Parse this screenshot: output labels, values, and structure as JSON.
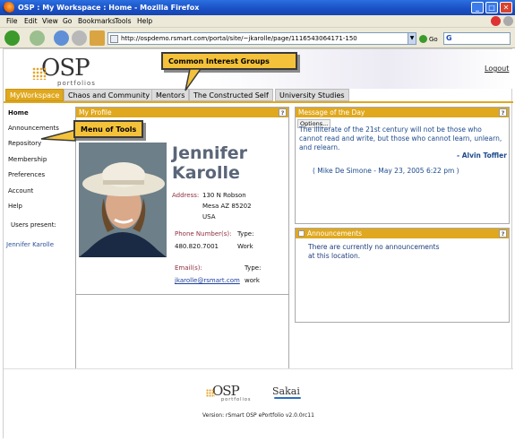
{
  "window": {
    "title": "OSP : My Workspace : Home - Mozilla Firefox",
    "controls": [
      "_",
      "□",
      "✕"
    ]
  },
  "menubar": [
    "File",
    "Edit",
    "View",
    "Go",
    "Bookmarks",
    "Tools",
    "Help"
  ],
  "toolbar": {
    "url": "http://ospdemo.rsmart.com/portal/site/~jkarolle/page/1116543064171-150",
    "go_label": "Go",
    "search_glyph": "G"
  },
  "header": {
    "logo_main": "OSP",
    "logo_sub": "portfolios",
    "logout": "Logout"
  },
  "tabs": [
    "MyWorkspace",
    "Chaos and Community",
    "Mentors",
    "The Constructed Self",
    "University Studies"
  ],
  "sidebar": {
    "items": [
      "Home",
      "Announcements",
      "Repository",
      "Membership",
      "Preferences",
      "Account",
      "Help"
    ],
    "users_present_label": "Users present:",
    "user": "Jennifer Karolle"
  },
  "profile": {
    "title": "My Profile",
    "help": "?",
    "first_name": "Jennifer",
    "last_name": "Karolle",
    "address_label": "Address:",
    "address_lines": [
      "130 N Robson",
      "Mesa AZ 85202",
      "USA"
    ],
    "phone_label": "Phone Number(s):",
    "type_label": "Type:",
    "phone": "480.820.7001",
    "phone_type": "Work",
    "email_label": "Email(s):",
    "email_type_label": "Type:",
    "email": "jkarolle@rsmart.com",
    "email_type": "work"
  },
  "motd": {
    "title": "Message of the Day",
    "help": "?",
    "options": "Options...",
    "quote": "The illiterate of the 21st century will not be those who cannot read and write, but those who cannot learn, unlearn, and relearn.",
    "author": "- Alvin Toffler",
    "credit": "( Mike De Simone - May 23, 2005 6:22 pm )"
  },
  "announcements": {
    "title": "Announcements",
    "help": "?",
    "message": "There are currently no announcements at this location."
  },
  "callouts": {
    "groups": "Common Interest Groups",
    "tools": "Menu of Tools"
  },
  "footer": {
    "osp": "OSP",
    "osp_sub": "portfolios",
    "sakai": "Sakai",
    "version": "Version: rSmart OSP ePortfolio v2.0.0rc11"
  },
  "colors": {
    "accent": "#e0a81e",
    "callout": "#f4c23a",
    "link": "#1f3f9f",
    "label": "#8e2f3f"
  }
}
